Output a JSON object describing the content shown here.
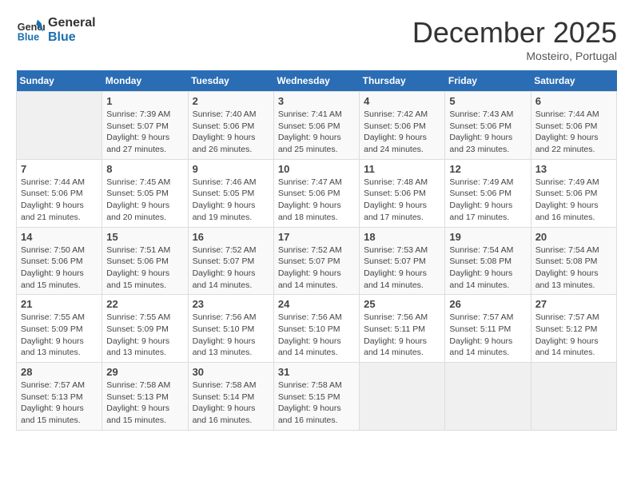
{
  "header": {
    "logo_line1": "General",
    "logo_line2": "Blue",
    "month": "December 2025",
    "location": "Mosteiro, Portugal"
  },
  "weekdays": [
    "Sunday",
    "Monday",
    "Tuesday",
    "Wednesday",
    "Thursday",
    "Friday",
    "Saturday"
  ],
  "weeks": [
    [
      {
        "day": "",
        "empty": true
      },
      {
        "day": "1",
        "sunrise": "7:39 AM",
        "sunset": "5:07 PM",
        "daylight": "9 hours and 27 minutes."
      },
      {
        "day": "2",
        "sunrise": "7:40 AM",
        "sunset": "5:06 PM",
        "daylight": "9 hours and 26 minutes."
      },
      {
        "day": "3",
        "sunrise": "7:41 AM",
        "sunset": "5:06 PM",
        "daylight": "9 hours and 25 minutes."
      },
      {
        "day": "4",
        "sunrise": "7:42 AM",
        "sunset": "5:06 PM",
        "daylight": "9 hours and 24 minutes."
      },
      {
        "day": "5",
        "sunrise": "7:43 AM",
        "sunset": "5:06 PM",
        "daylight": "9 hours and 23 minutes."
      },
      {
        "day": "6",
        "sunrise": "7:44 AM",
        "sunset": "5:06 PM",
        "daylight": "9 hours and 22 minutes."
      }
    ],
    [
      {
        "day": "7",
        "sunrise": "7:44 AM",
        "sunset": "5:06 PM",
        "daylight": "9 hours and 21 minutes."
      },
      {
        "day": "8",
        "sunrise": "7:45 AM",
        "sunset": "5:05 PM",
        "daylight": "9 hours and 20 minutes."
      },
      {
        "day": "9",
        "sunrise": "7:46 AM",
        "sunset": "5:05 PM",
        "daylight": "9 hours and 19 minutes."
      },
      {
        "day": "10",
        "sunrise": "7:47 AM",
        "sunset": "5:06 PM",
        "daylight": "9 hours and 18 minutes."
      },
      {
        "day": "11",
        "sunrise": "7:48 AM",
        "sunset": "5:06 PM",
        "daylight": "9 hours and 17 minutes."
      },
      {
        "day": "12",
        "sunrise": "7:49 AM",
        "sunset": "5:06 PM",
        "daylight": "9 hours and 17 minutes."
      },
      {
        "day": "13",
        "sunrise": "7:49 AM",
        "sunset": "5:06 PM",
        "daylight": "9 hours and 16 minutes."
      }
    ],
    [
      {
        "day": "14",
        "sunrise": "7:50 AM",
        "sunset": "5:06 PM",
        "daylight": "9 hours and 15 minutes."
      },
      {
        "day": "15",
        "sunrise": "7:51 AM",
        "sunset": "5:06 PM",
        "daylight": "9 hours and 15 minutes."
      },
      {
        "day": "16",
        "sunrise": "7:52 AM",
        "sunset": "5:07 PM",
        "daylight": "9 hours and 14 minutes."
      },
      {
        "day": "17",
        "sunrise": "7:52 AM",
        "sunset": "5:07 PM",
        "daylight": "9 hours and 14 minutes."
      },
      {
        "day": "18",
        "sunrise": "7:53 AM",
        "sunset": "5:07 PM",
        "daylight": "9 hours and 14 minutes."
      },
      {
        "day": "19",
        "sunrise": "7:54 AM",
        "sunset": "5:08 PM",
        "daylight": "9 hours and 14 minutes."
      },
      {
        "day": "20",
        "sunrise": "7:54 AM",
        "sunset": "5:08 PM",
        "daylight": "9 hours and 13 minutes."
      }
    ],
    [
      {
        "day": "21",
        "sunrise": "7:55 AM",
        "sunset": "5:09 PM",
        "daylight": "9 hours and 13 minutes."
      },
      {
        "day": "22",
        "sunrise": "7:55 AM",
        "sunset": "5:09 PM",
        "daylight": "9 hours and 13 minutes."
      },
      {
        "day": "23",
        "sunrise": "7:56 AM",
        "sunset": "5:10 PM",
        "daylight": "9 hours and 13 minutes."
      },
      {
        "day": "24",
        "sunrise": "7:56 AM",
        "sunset": "5:10 PM",
        "daylight": "9 hours and 14 minutes."
      },
      {
        "day": "25",
        "sunrise": "7:56 AM",
        "sunset": "5:11 PM",
        "daylight": "9 hours and 14 minutes."
      },
      {
        "day": "26",
        "sunrise": "7:57 AM",
        "sunset": "5:11 PM",
        "daylight": "9 hours and 14 minutes."
      },
      {
        "day": "27",
        "sunrise": "7:57 AM",
        "sunset": "5:12 PM",
        "daylight": "9 hours and 14 minutes."
      }
    ],
    [
      {
        "day": "28",
        "sunrise": "7:57 AM",
        "sunset": "5:13 PM",
        "daylight": "9 hours and 15 minutes."
      },
      {
        "day": "29",
        "sunrise": "7:58 AM",
        "sunset": "5:13 PM",
        "daylight": "9 hours and 15 minutes."
      },
      {
        "day": "30",
        "sunrise": "7:58 AM",
        "sunset": "5:14 PM",
        "daylight": "9 hours and 16 minutes."
      },
      {
        "day": "31",
        "sunrise": "7:58 AM",
        "sunset": "5:15 PM",
        "daylight": "9 hours and 16 minutes."
      },
      {
        "day": "",
        "empty": true
      },
      {
        "day": "",
        "empty": true
      },
      {
        "day": "",
        "empty": true
      }
    ]
  ]
}
